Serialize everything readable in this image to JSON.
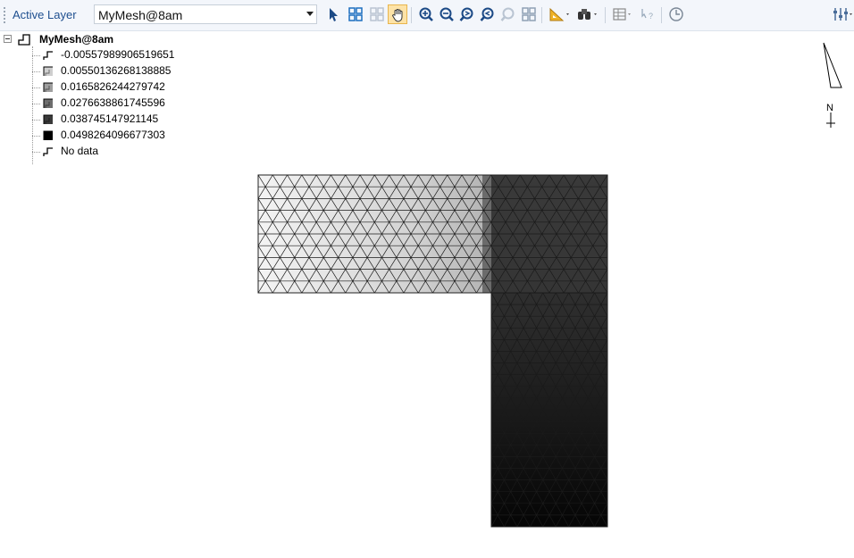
{
  "toolbar": {
    "active_layer_label": "Active Layer",
    "active_layer_value": "MyMesh@8am",
    "tools": [
      {
        "name": "select-arrow-icon",
        "active": false
      },
      {
        "name": "select-all-icon",
        "active": false
      },
      {
        "name": "deselect-icon",
        "active": false
      },
      {
        "name": "pan-hand-icon",
        "active": true
      },
      {
        "name": "zoom-in-icon",
        "active": false
      },
      {
        "name": "zoom-out-icon",
        "active": false
      },
      {
        "name": "zoom-previous-icon",
        "active": false
      },
      {
        "name": "zoom-next-icon",
        "active": false
      },
      {
        "name": "zoom-layer-icon",
        "active": false
      },
      {
        "name": "zoom-extent-icon",
        "active": false
      },
      {
        "name": "measure-icon",
        "active": false
      },
      {
        "name": "identify-icon",
        "active": false
      },
      {
        "name": "attribute-table-icon",
        "active": false
      },
      {
        "name": "whats-this-icon",
        "active": false
      },
      {
        "name": "time-icon",
        "active": false
      },
      {
        "name": "settings-icon",
        "active": false
      }
    ]
  },
  "legend": {
    "layer_name": "MyMesh@8am",
    "items": [
      {
        "label": "-0.00557989906519651",
        "color": "#ffffff",
        "style": "hook"
      },
      {
        "label": "0.00550136268138885",
        "color": "#cfcfcf",
        "style": "box"
      },
      {
        "label": "0.0165826244279742",
        "color": "#9f9f9f",
        "style": "box"
      },
      {
        "label": "0.0276638861745596",
        "color": "#6e6e6e",
        "style": "box"
      },
      {
        "label": "0.038745147921145",
        "color": "#3a3a3a",
        "style": "box"
      },
      {
        "label": "0.0498264096677303",
        "color": "#000000",
        "style": "box"
      },
      {
        "label": "No data",
        "color": "#ffffff",
        "style": "hook"
      }
    ]
  },
  "north_arrow": {
    "label": "N"
  }
}
